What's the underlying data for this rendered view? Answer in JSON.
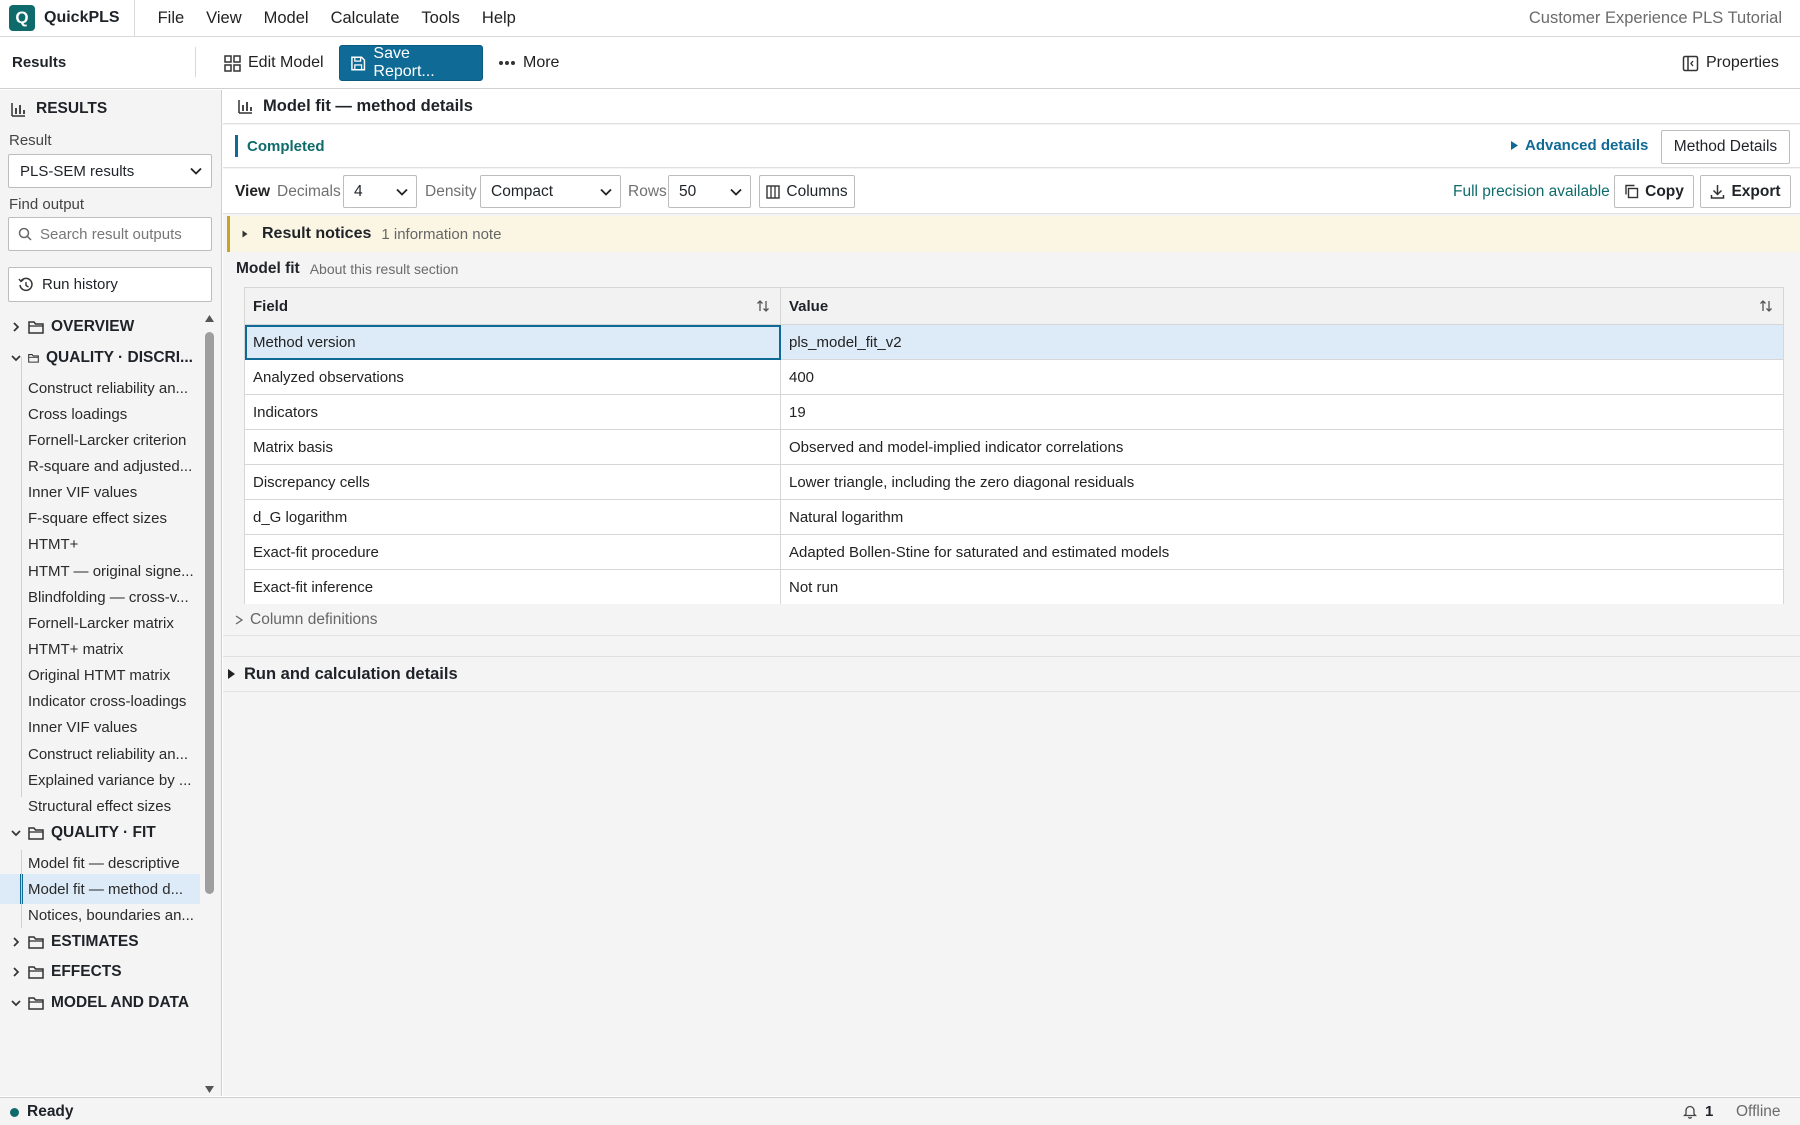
{
  "app": {
    "name": "QuickPLS",
    "project_title": "Customer Experience PLS Tutorial",
    "accent": "#0f6b96"
  },
  "menu": [
    "File",
    "View",
    "Model",
    "Calculate",
    "Tools",
    "Help"
  ],
  "toolbar": {
    "section": "Results",
    "edit_label": "Edit Model",
    "save_label": "Save Report...",
    "more_label": "More",
    "properties_label": "Properties"
  },
  "sidebar": {
    "heading": "RESULTS",
    "result_label": "Result",
    "result_value": "PLS-SEM results",
    "find_label": "Find output",
    "search_placeholder": "Search result outputs",
    "run_history": "Run history",
    "tree": [
      {
        "type": "group",
        "label": "OVERVIEW",
        "expanded": false
      },
      {
        "type": "group",
        "label": "QUALITY · DISCRI...",
        "expanded": true,
        "small": true
      },
      {
        "type": "leaf",
        "label": "Construct reliability an..."
      },
      {
        "type": "leaf",
        "label": "Cross loadings"
      },
      {
        "type": "leaf",
        "label": "Fornell-Larcker criterion"
      },
      {
        "type": "leaf",
        "label": "R-square and adjusted..."
      },
      {
        "type": "leaf",
        "label": "Inner VIF values"
      },
      {
        "type": "leaf",
        "label": "F-square effect sizes"
      },
      {
        "type": "leaf",
        "label": "HTMT+"
      },
      {
        "type": "leaf",
        "label": "HTMT — original signe..."
      },
      {
        "type": "leaf",
        "label": "Blindfolding — cross-v..."
      },
      {
        "type": "leaf",
        "label": "Fornell-Larcker matrix"
      },
      {
        "type": "leaf",
        "label": "HTMT+ matrix"
      },
      {
        "type": "leaf",
        "label": "Original HTMT matrix"
      },
      {
        "type": "leaf",
        "label": "Indicator cross-loadings"
      },
      {
        "type": "leaf",
        "label": "Inner VIF values"
      },
      {
        "type": "leaf",
        "label": "Construct reliability an..."
      },
      {
        "type": "leaf",
        "label": "Explained variance by ..."
      },
      {
        "type": "leaf",
        "label": "Structural effect sizes"
      },
      {
        "type": "group",
        "label": "QUALITY · FIT",
        "expanded": true
      },
      {
        "type": "leaf",
        "label": "Model fit — descriptive"
      },
      {
        "type": "leaf",
        "label": "Model fit — method d...",
        "active": true
      },
      {
        "type": "leaf",
        "label": "Notices, boundaries an..."
      },
      {
        "type": "group",
        "label": "ESTIMATES",
        "expanded": false
      },
      {
        "type": "group",
        "label": "EFFECTS",
        "expanded": false
      },
      {
        "type": "group",
        "label": "MODEL AND DATA",
        "expanded": true
      }
    ]
  },
  "main": {
    "title": "Model fit — method details",
    "status": "Completed",
    "advanced_details": "Advanced details",
    "method_details_button": "Method Details",
    "view": {
      "label": "View",
      "decimals_label": "Decimals",
      "decimals_value": "4",
      "density_label": "Density",
      "density_value": "Compact",
      "rows_label": "Rows",
      "rows_value": "50",
      "columns_label": "Columns",
      "precision_note": "Full precision available",
      "copy_label": "Copy",
      "export_label": "Export"
    },
    "notices": {
      "title": "Result notices",
      "summary": "1 information note"
    },
    "section": {
      "title": "Model fit",
      "subtitle": "About this result section"
    },
    "table": {
      "columns": [
        "Field",
        "Value"
      ],
      "rows": [
        [
          "Method version",
          "pls_model_fit_v2"
        ],
        [
          "Analyzed observations",
          "400"
        ],
        [
          "Indicators",
          "19"
        ],
        [
          "Matrix basis",
          "Observed and model-implied indicator correlations"
        ],
        [
          "Discrepancy cells",
          "Lower triangle, including the zero diagonal residuals"
        ],
        [
          "d_G logarithm",
          "Natural logarithm"
        ],
        [
          "Exact-fit procedure",
          "Adapted Bollen-Stine for saturated and estimated models"
        ],
        [
          "Exact-fit inference",
          "Not run"
        ]
      ]
    },
    "column_definitions": "Column definitions",
    "run_details": "Run and calculation details"
  },
  "status": {
    "ready": "Ready",
    "notifications": "1",
    "connection": "Offline"
  }
}
